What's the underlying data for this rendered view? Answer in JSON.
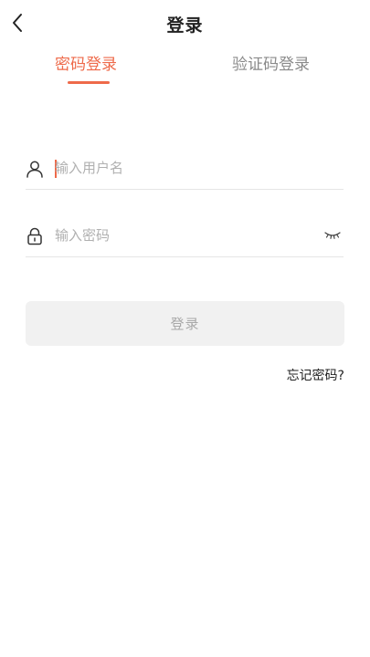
{
  "header": {
    "title": "登录",
    "back_icon": "chevron-left-icon"
  },
  "tabs": [
    {
      "label": "密码登录",
      "active": true
    },
    {
      "label": "验证码登录",
      "active": false
    }
  ],
  "form": {
    "username": {
      "placeholder": "输入用户名",
      "value": "",
      "icon": "user-icon"
    },
    "password": {
      "placeholder": "输入密码",
      "value": "",
      "icon": "lock-icon",
      "toggle_icon": "eye-closed-icon"
    },
    "submit_label": "登录",
    "forgot_label": "忘记密码?"
  },
  "colors": {
    "accent": "#ee6a4a",
    "button_bg": "#f1f1f1",
    "button_text": "#a8a8a8"
  }
}
